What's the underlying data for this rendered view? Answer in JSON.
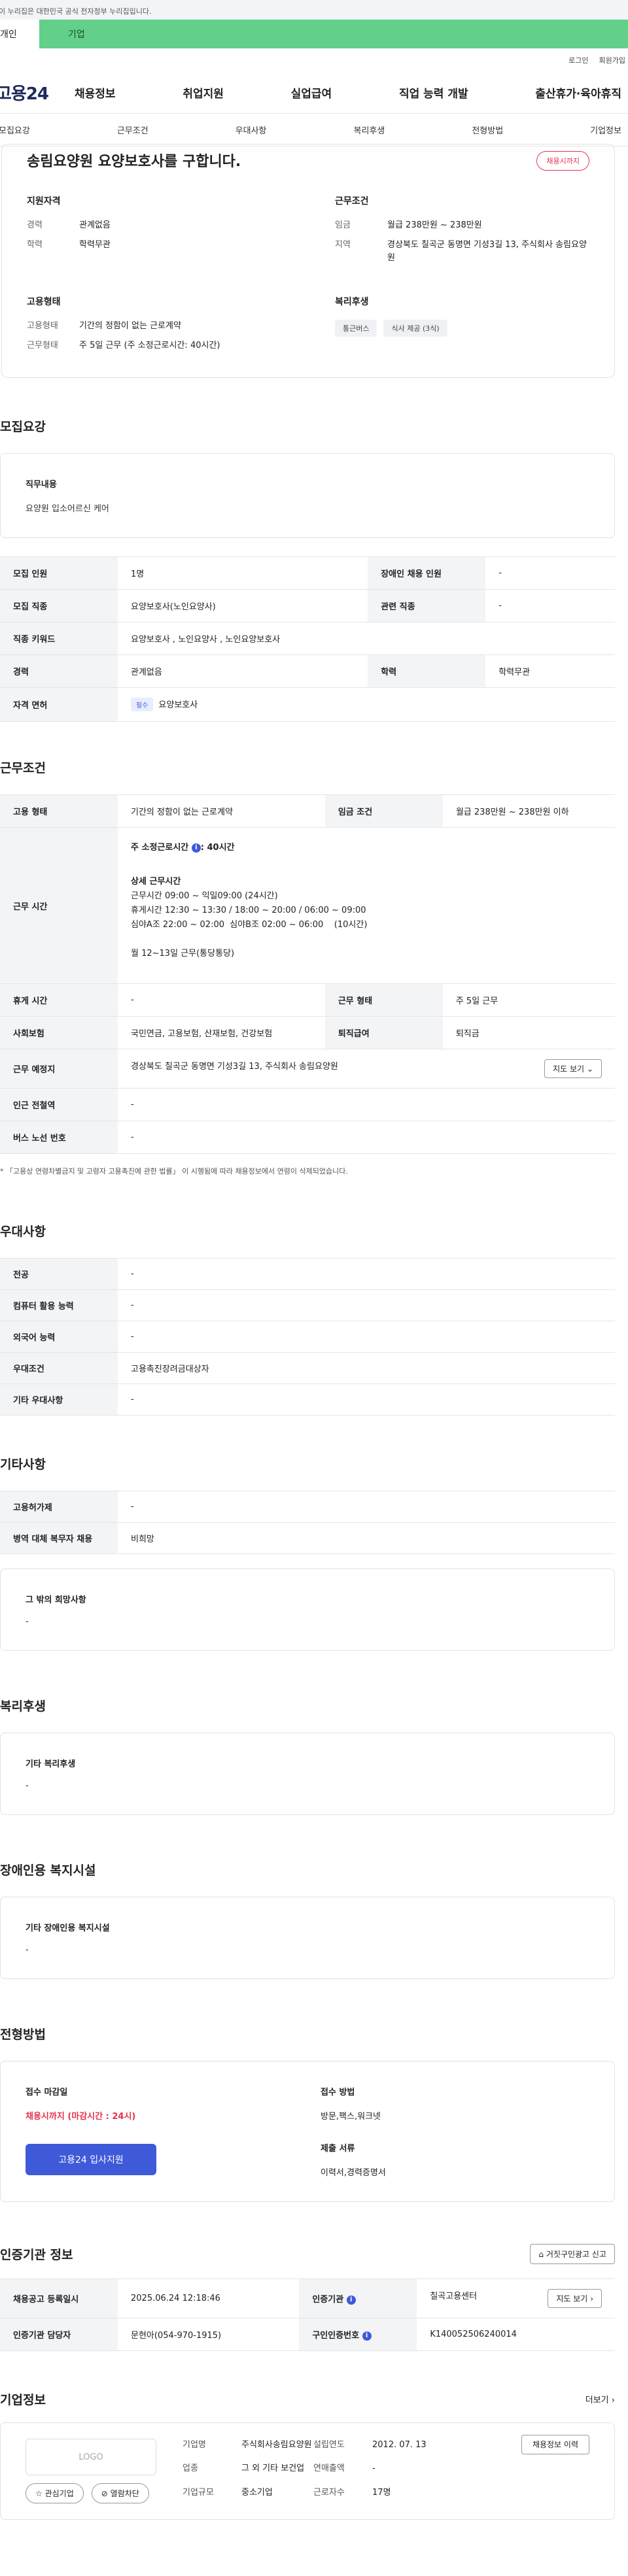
{
  "gov_banner": "이 누리집은 대한민국 공식 전자정부 누리집입니다.",
  "top_tabs": [
    "개인",
    "기업"
  ],
  "util": [
    "로그인",
    "회원가입"
  ],
  "logo": "고용24",
  "gnb": [
    "채용정보",
    "취업지원",
    "실업급여",
    "직업 능력 개발",
    "출산휴가·육아휴직"
  ],
  "snb": [
    "모집요강",
    "근무조건",
    "우대사항",
    "복리후생",
    "전형방법",
    "기업정보"
  ],
  "summary": {
    "title": "송림요양원 요양보호사를 구합니다.",
    "badge": "채용시까지",
    "qual_title": "지원자격",
    "qual": [
      {
        "k": "경력",
        "v": "관계없음"
      },
      {
        "k": "학력",
        "v": "학력무관"
      }
    ],
    "cond_title": "근무조건",
    "cond": [
      {
        "k": "임금",
        "v": "월급 238만원 ~ 238만원"
      },
      {
        "k": "지역",
        "v": "경상북도 칠곡군 동명면 기성3길 13, 주식회사 송림요양원"
      }
    ],
    "emp_title": "고용형태",
    "emp": [
      {
        "k": "고용형태",
        "v": "기간의 정함이 없는 근로계약"
      },
      {
        "k": "근무형태",
        "v": "주 5일 근무 (주 소정근로시간: 40시간)"
      }
    ],
    "welfare_title": "복리후생",
    "welfare": [
      "통근버스",
      "식사 제공 (3식)"
    ]
  },
  "recruit": {
    "title": "모집요강",
    "duty_title": "직무내용",
    "duty": "요양원 입소어르신 케어",
    "rows": {
      "count_k": "모집 인원",
      "count_v": "1명",
      "disabled_k": "장애인 채용 인원",
      "disabled_v": "-",
      "job_k": "모집 직종",
      "job_v": "요양보호사(노인요양사)",
      "rel_k": "관련 직종",
      "rel_v": "-",
      "kw_k": "직종 키워드",
      "kw_v": "요양보호사 , 노인요양사 , 노인요양보호사",
      "career_k": "경력",
      "career_v": "관계없음",
      "edu_k": "학력",
      "edu_v": "학력무관",
      "license_k": "자격 면허",
      "license_tag": "필수",
      "license_v": "요양보호사"
    }
  },
  "work": {
    "title": "근무조건",
    "type_k": "고용 형태",
    "type_v": "기간의 정함이 없는 근로계약",
    "wage_k": "임금 조건",
    "wage_v": "월급 238만원 ~ 238만원 이하",
    "time_k": "근무 시간",
    "time_main": "주 소정근로시간",
    "time_main_v": ": 40시간",
    "time_detail_title": "상세 근무시간",
    "time_lines": [
      "근무시간 09:00 ~ 익일09:00 (24시간)",
      "휴게시간 12:30 ~ 13:30 / 18:00 ~ 20:00 / 06:00 ~ 09:00",
      "심야A조 22:00 ~ 02:00  심야B조 02:00 ~ 06:00    (10시간)",
      "",
      "월 12~13일 근무(통당통당)"
    ],
    "rest_k": "휴게 시간",
    "rest_v": "-",
    "form_k": "근무 형태",
    "form_v": "주 5일 근무",
    "ins_k": "사회보험",
    "ins_v": "국민연금, 고용보험, 산재보험, 건강보험",
    "sev_k": "퇴직급여",
    "sev_v": "퇴직금",
    "place_k": "근무 예정지",
    "place_v": "경상북도 칠곡군 동명면 기성3길 13, 주식회사 송림요양원",
    "map_btn": "지도 보기",
    "station_k": "인근 전철역",
    "station_v": "-",
    "bus_k": "버스 노선 번호",
    "bus_v": "-",
    "notice": "* 「고용상 연령차별금지 및 고령자 고용촉진에 관한 법률」 이 시행됨에 따라 채용정보에서 연령이 삭제되었습니다."
  },
  "pref": {
    "title": "우대사항",
    "rows": [
      {
        "k": "전공",
        "v": "-"
      },
      {
        "k": "컴퓨터 활용 능력",
        "v": "-"
      },
      {
        "k": "외국어 능력",
        "v": "-"
      },
      {
        "k": "우대조건",
        "v": "고용촉진장려금대상자"
      },
      {
        "k": "기타 우대사항",
        "v": "-"
      }
    ]
  },
  "etc": {
    "title": "기타사항",
    "rows": [
      {
        "k": "고용허가제",
        "v": "-"
      },
      {
        "k": "병역 대체 복무자 채용",
        "v": "비희망"
      }
    ],
    "other_title": "그 밖의 희망사항",
    "other_v": "-"
  },
  "welfare": {
    "title": "복리후생",
    "card_title": "기타 복리후생",
    "card_v": "-"
  },
  "disabled": {
    "title": "장애인용 복지시설",
    "card_title": "기타 장애인용 복지시설",
    "card_v": "-"
  },
  "process": {
    "title": "전형방법",
    "deadline_k": "접수 마감일",
    "deadline_v": "채용시까지 (마감시간 : 24시)",
    "apply_btn": "고용24 입사지원",
    "method_k": "접수 방법",
    "method_v": "방문,팩스,워크넷",
    "docs_k": "제출 서류",
    "docs_v": "이력서,경력증명서"
  },
  "agency": {
    "title": "인증기관 정보",
    "report": "거짓구인광고 신고",
    "date_k": "채용공고 등록일시",
    "date_v": "2025.06.24 12:18:46",
    "org_k": "인증기관",
    "org_v": "칠곡고용센터",
    "map_btn": "지도 보기",
    "staff_k": "인증기관 담당자",
    "staff_v": "문현아(054-970-1915)",
    "no_k": "구인인증번호",
    "no_v": "K140052506240014"
  },
  "company": {
    "title": "기업정보",
    "more": "더보기",
    "logo": "LOGO",
    "fav": "관심기업",
    "block": "열람차단",
    "name_k": "기업명",
    "name_v": "주식회사송림요양원",
    "year_k": "설립연도",
    "year_v": "2012. 07. 13",
    "ind_k": "업종",
    "ind_v": "그 외 기타 보건업",
    "sales_k": "연매출액",
    "sales_v": "-",
    "size_k": "기업규모",
    "size_v": "중소기업",
    "emp_k": "근로자수",
    "emp_v": "17명",
    "history_btn": "채용정보 이력"
  }
}
